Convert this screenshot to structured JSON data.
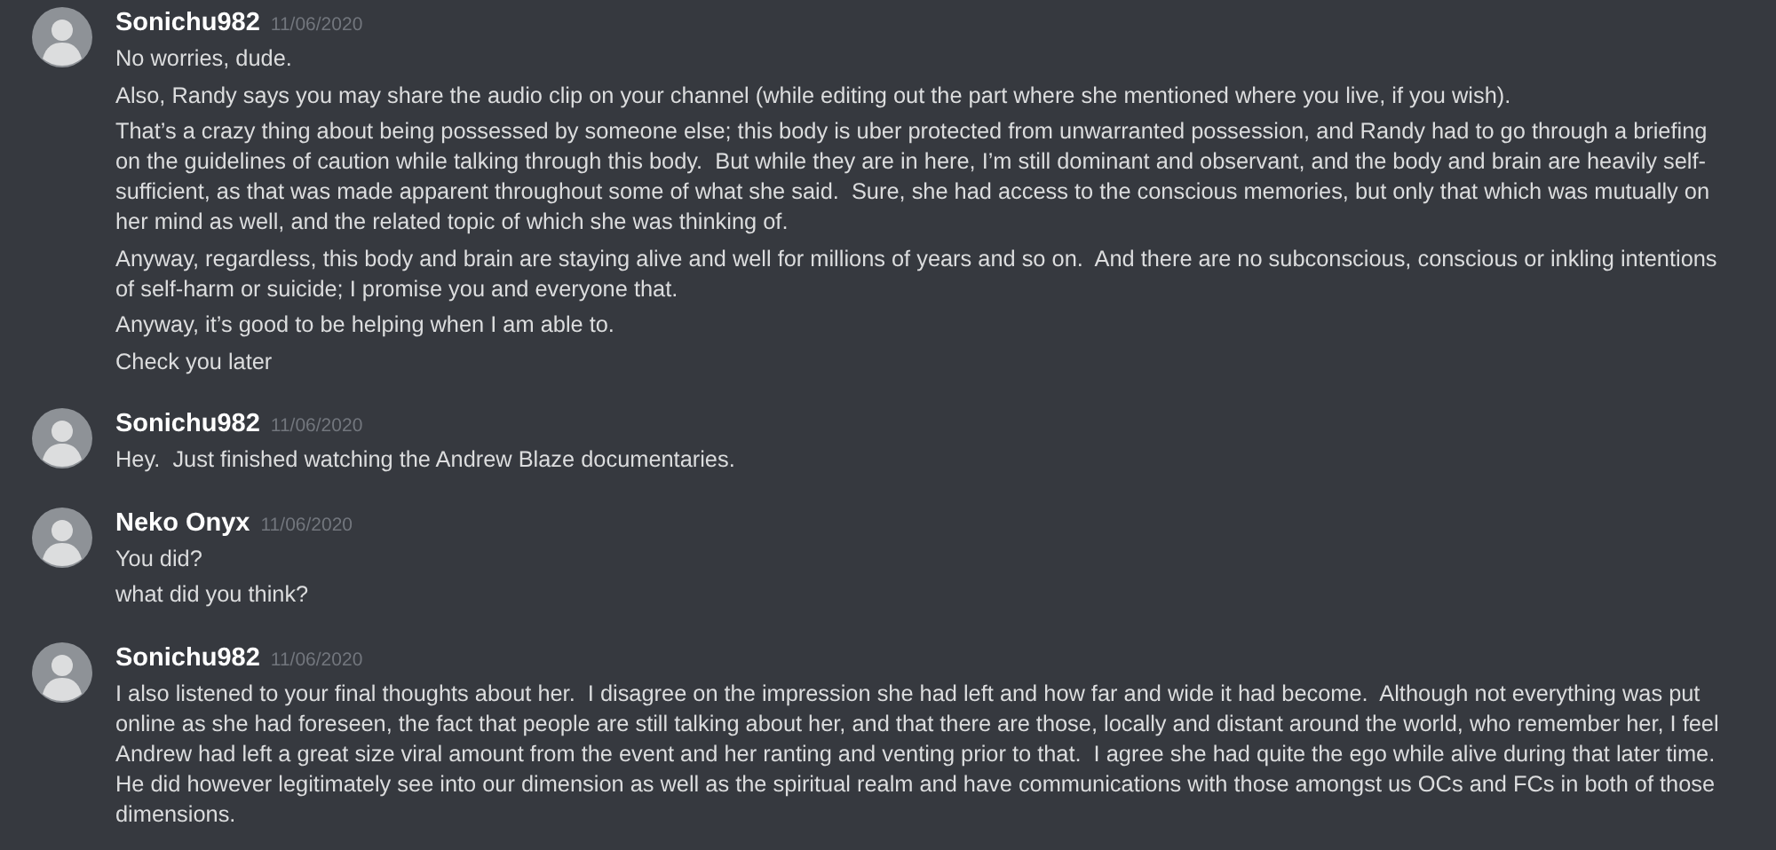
{
  "messages": [
    {
      "author": "Sonichu982",
      "timestamp": "11/06/2020",
      "lines": [
        "No worries, dude.",
        "Also, Randy says you may share the audio clip on your channel (while editing out the part where she mentioned where you live, if you wish).",
        "That’s a crazy thing about being possessed by someone else; this body is uber protected from unwarranted possession, and Randy had to go through a briefing on the guidelines of caution while talking through this body.  But while they are in here, I’m still dominant and observant, and the body and brain are heavily self-sufficient, as that was made apparent throughout some of what she said.  Sure, she had access to the conscious memories, but only that which was mutually on her mind as well, and the related topic of which she was thinking of.",
        "Anyway, regardless, this body and brain are staying alive and well for millions of years and so on.  And there are no subconscious, conscious or inkling intentions of self-harm or suicide; I promise you and everyone that.",
        "Anyway, it’s good to be helping when I am able to.",
        "Check you later"
      ]
    },
    {
      "author": "Sonichu982",
      "timestamp": "11/06/2020",
      "lines": [
        "Hey.  Just finished watching the Andrew Blaze documentaries."
      ]
    },
    {
      "author": "Neko Onyx",
      "timestamp": "11/06/2020",
      "lines": [
        "You did?",
        "what did you think?"
      ]
    },
    {
      "author": "Sonichu982",
      "timestamp": "11/06/2020",
      "lines": [
        "I also listened to your final thoughts about her.  I disagree on the impression she had left and how far and wide it had become.  Although not everything was put online as she had foreseen, the fact that people are still talking about her, and that there are those, locally and distant around the world, who remember her, I feel Andrew had left a great size viral amount from the event and her ranting and venting prior to that.  I agree she had quite the ego while alive during that later time.  He did however legitimately see into our dimension as well as the spiritual realm and have communications with those amongst us OCs and FCs in both of those dimensions."
      ]
    }
  ]
}
